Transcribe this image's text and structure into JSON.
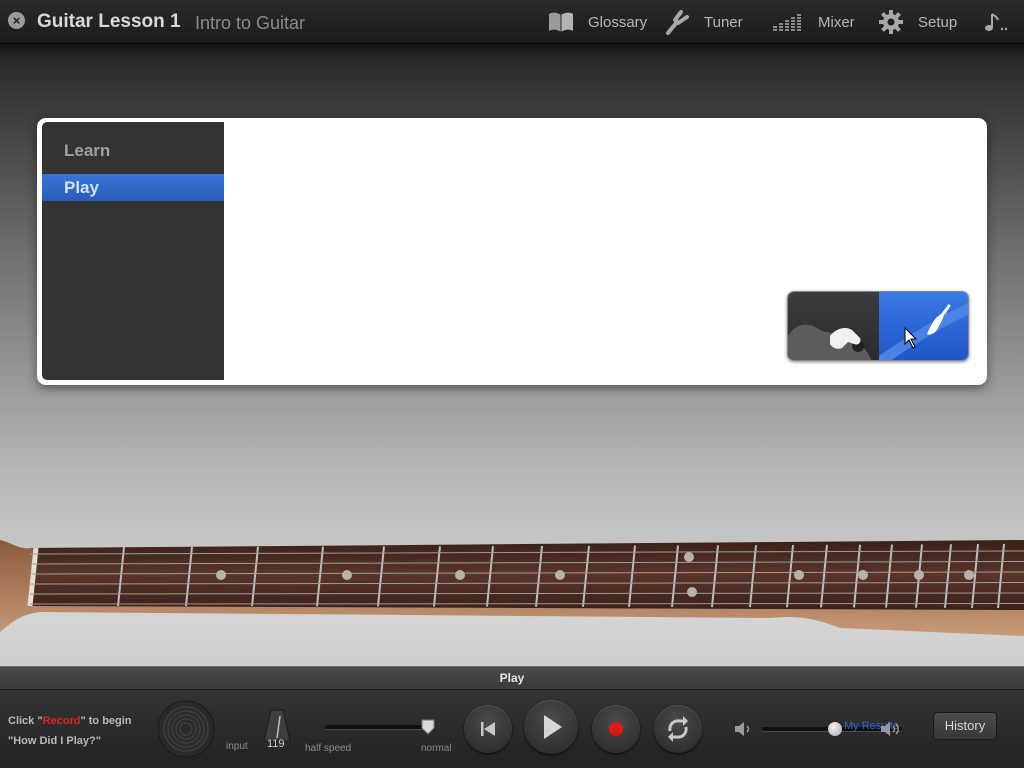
{
  "header": {
    "lesson_title": "Guitar Lesson 1",
    "lesson_subtitle": "Intro to Guitar",
    "glossary_label": "Glossary",
    "tuner_label": "Tuner",
    "mixer_label": "Mixer",
    "setup_label": "Setup"
  },
  "menu": {
    "items": [
      {
        "label": "Learn",
        "selected": false
      },
      {
        "label": "Play",
        "selected": true
      }
    ]
  },
  "view_toggle": {
    "left_icon": "hand-on-guitar-body-icon",
    "right_icon": "hand-on-guitar-neck-icon",
    "selected": "right"
  },
  "track_bar": {
    "title": "Play"
  },
  "controls": {
    "hint_line1_prefix": "Click \"",
    "hint_record_word": "Record",
    "hint_line1_suffix": "\" to begin",
    "hint_line2": "\"How Did I Play?\"",
    "input_label": "input",
    "tempo_value": "119",
    "speed_min_label": "half speed",
    "speed_max_label": "normal",
    "speed_value": 1.0,
    "volume_value": 0.74,
    "my_results_label": "My Results",
    "history_label": "History"
  },
  "colors": {
    "accent_blue": "#2a5db8",
    "record_red": "#e02424",
    "fretboard": "#4a2b22"
  }
}
